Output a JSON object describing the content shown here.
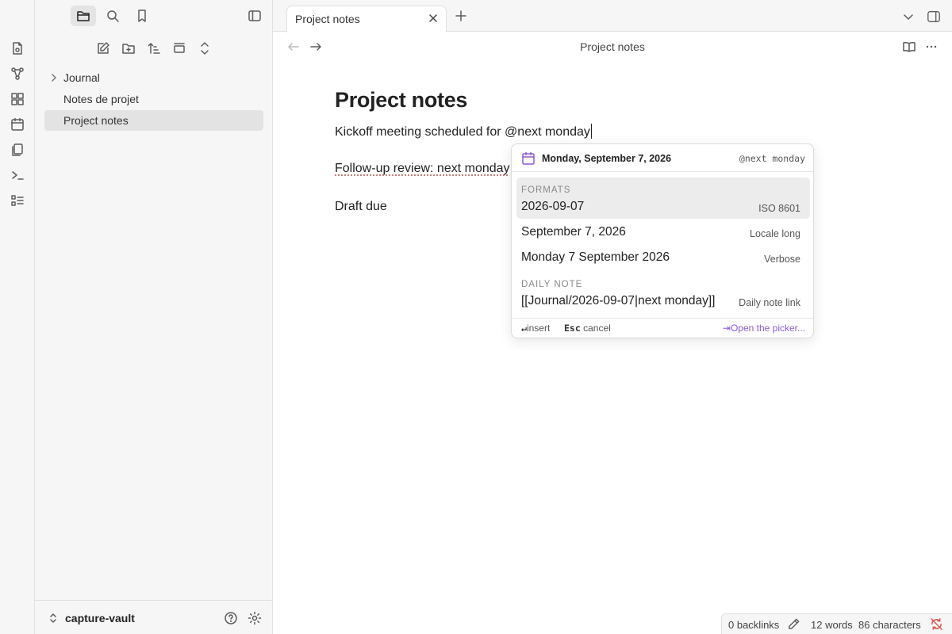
{
  "sidebar": {
    "tree": [
      {
        "label": "Journal",
        "type": "folder"
      },
      {
        "label": "Notes de projet",
        "type": "file"
      },
      {
        "label": "Project notes",
        "type": "file",
        "active": true
      }
    ],
    "vault_name": "capture-vault"
  },
  "tabs": [
    {
      "title": "Project notes"
    }
  ],
  "view": {
    "title": "Project notes"
  },
  "editor": {
    "title": "Project notes",
    "line1": "Kickoff meeting scheduled for @next monday",
    "line2": "Follow-up review: next monday",
    "line3": "Draft due"
  },
  "suggest": {
    "date_label": "Monday, September 7, 2026",
    "query": "@next monday",
    "formats_heading": "FORMATS",
    "options": [
      {
        "value": "2026-09-07",
        "label": "ISO 8601"
      },
      {
        "value": "September 7, 2026",
        "label": "Locale long"
      },
      {
        "value": "Monday 7 September 2026",
        "label": "Verbose"
      }
    ],
    "daily_heading": "DAILY NOTE",
    "daily": {
      "value": "[[Journal/2026-09-07|next monday]]",
      "label": "Daily note link"
    },
    "footer": {
      "insert_key": "↵",
      "insert_label": "insert",
      "cancel_key": "Esc",
      "cancel_label": "cancel",
      "picker_key": "⇥",
      "picker_label": "Open the picker..."
    }
  },
  "status": {
    "backlinks": "0 backlinks",
    "words": "12 words",
    "characters": "86 characters"
  },
  "colors": {
    "accent": "#8a5cd0",
    "calendar_icon": "#8a5cd0"
  }
}
